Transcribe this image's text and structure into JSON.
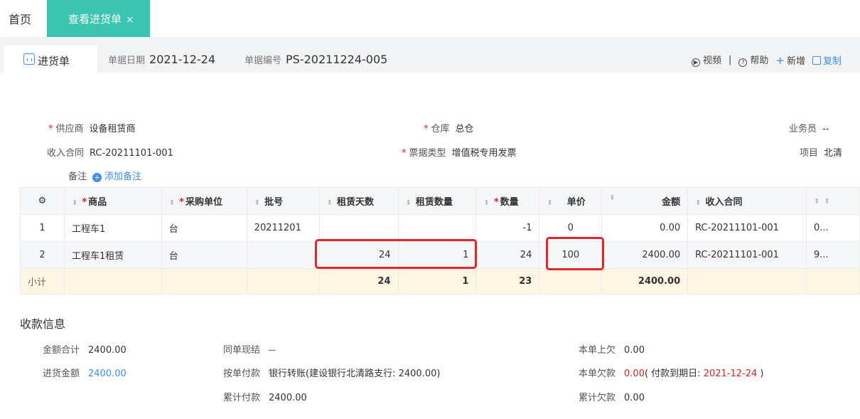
{
  "tabs": {
    "home": "首页",
    "active": "查看进货单",
    "close": "×"
  },
  "doc": {
    "tab_label": "进货单",
    "date_label": "单据日期",
    "date": "2021-12-24",
    "no_label": "单据编号",
    "no": "PS-20211224-005"
  },
  "toolbar": {
    "video": "视频",
    "sep": "|",
    "help": "帮助",
    "add": "新增",
    "copy": "复制"
  },
  "form": {
    "supplier_label": "供应商",
    "supplier": "设备租赁商",
    "warehouse_label": "仓库",
    "warehouse": "总仓",
    "salesman_label": "业务员",
    "salesman": "--",
    "contract_label": "收入合同",
    "contract": "RC-20211101-001",
    "invoice_label": "票据类型",
    "invoice": "增值税专用发票",
    "project_label": "项目",
    "project": "北清",
    "note_label": "备注",
    "add_note": "添加备注"
  },
  "table": {
    "headers": {
      "product": "商品",
      "unit": "采购单位",
      "batch": "批号",
      "days": "租赁天数",
      "rent_qty": "租赁数量",
      "qty": "数量",
      "price": "单价",
      "amount": "金额",
      "contract": "收入合同"
    },
    "rows": [
      {
        "idx": "1",
        "product": "工程车1",
        "unit": "台",
        "batch": "20211201",
        "days": "",
        "rent_qty": "",
        "qty": "-1",
        "price": "0",
        "amount": "0.00",
        "contract": "RC-20211101-001",
        "extra": "0..."
      },
      {
        "idx": "2",
        "product": "工程车1租赁",
        "unit": "台",
        "batch": "",
        "days": "24",
        "rent_qty": "1",
        "qty": "24",
        "price": "100",
        "amount": "2400.00",
        "contract": "RC-20211101-001",
        "extra": "9..."
      }
    ],
    "subtotal": {
      "label": "小计",
      "days": "24",
      "rent_qty": "1",
      "qty": "23",
      "amount": "2400.00"
    }
  },
  "payment": {
    "title": "收款信息",
    "total_label": "金额合计",
    "total": "2400.00",
    "purchase_label": "进货金额",
    "purchase": "2400.00",
    "same_label": "同单现结",
    "same": "--",
    "bill_label": "按单付款",
    "bill": "银行转账(建设银行北清路支行: 2400.00)",
    "cum_label": "累计付款",
    "cum": "2400.00",
    "prev_label": "本单上欠",
    "prev": "0.00",
    "owe_label": "本单欠款",
    "owe": "0.00",
    "due_prefix": "( 付款到期日: ",
    "due": "2021-12-24",
    "due_suffix": " )",
    "cum_owe_label": "累计欠款",
    "cum_owe": "0.00"
  },
  "colors": {
    "accent": "#3ac5b0",
    "link": "#3b8cf5",
    "required": "#e02020",
    "highlight": "#e8242b"
  }
}
